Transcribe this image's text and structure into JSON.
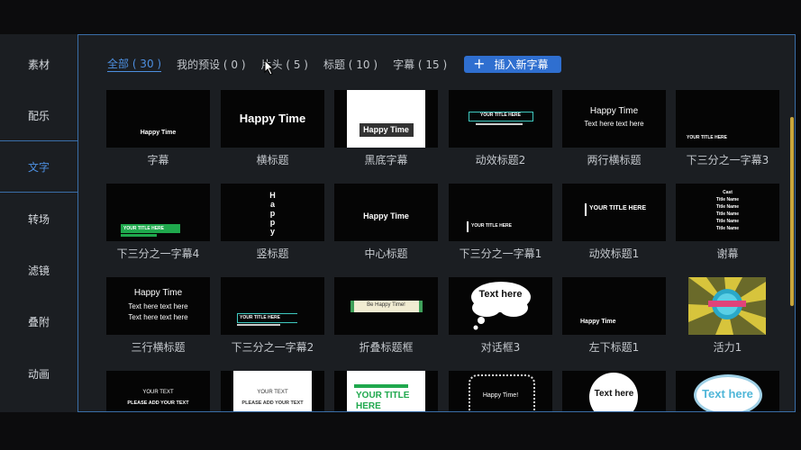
{
  "sidebar": {
    "items": [
      {
        "label": "素材"
      },
      {
        "label": "配乐"
      },
      {
        "label": "文字"
      },
      {
        "label": "转场"
      },
      {
        "label": "滤镜"
      },
      {
        "label": "叠附"
      },
      {
        "label": "动画"
      }
    ],
    "active_index": 2
  },
  "tabs": [
    {
      "label": "全部 ( 30 )"
    },
    {
      "label": "我的预设 ( 0 )"
    },
    {
      "label": "片头 ( 5 )"
    },
    {
      "label": "标题 ( 10 )"
    },
    {
      "label": "字幕 ( 15 )"
    }
  ],
  "insert_button": {
    "label": "插入新字幕"
  },
  "tiles": [
    {
      "label": "字幕",
      "preview": [
        "Happy Time"
      ]
    },
    {
      "label": "横标题",
      "preview": [
        "Happy Time"
      ]
    },
    {
      "label": "黑底字幕",
      "preview": [
        "Happy Time"
      ]
    },
    {
      "label": "动效标题2",
      "preview": [
        "YOUR TITLE HERE"
      ]
    },
    {
      "label": "两行横标题",
      "preview": [
        "Happy Time",
        "Text here text here"
      ]
    },
    {
      "label": "下三分之一字幕3",
      "preview": [
        "YOUR TITLE HERE"
      ]
    },
    {
      "label": "下三分之一字幕4",
      "preview": [
        "YOUR TITLE HERE"
      ]
    },
    {
      "label": "竖标题",
      "preview": [
        "H",
        "a",
        "p",
        "p",
        "y"
      ]
    },
    {
      "label": "中心标题",
      "preview": [
        "Happy Time"
      ]
    },
    {
      "label": "下三分之一字幕1",
      "preview": [
        "YOUR TITLE HERE"
      ]
    },
    {
      "label": "动效标题1",
      "preview": [
        "YOUR TITLE HERE"
      ]
    },
    {
      "label": "谢幕",
      "preview": [
        "Cast",
        "Title Name",
        "Title Name",
        "Title Name",
        "Title Name",
        "Title Name"
      ]
    },
    {
      "label": "三行横标题",
      "preview": [
        "Happy Time",
        "Text here text here",
        "Text here text here"
      ]
    },
    {
      "label": "下三分之一字幕2",
      "preview": [
        "YOUR TITLE HERE"
      ]
    },
    {
      "label": "折叠标题框",
      "preview": [
        "Be Happy Time!"
      ]
    },
    {
      "label": "对话框3",
      "preview": [
        "Text here"
      ]
    },
    {
      "label": "左下标题1",
      "preview": [
        "Happy Time"
      ]
    },
    {
      "label": "活力1",
      "preview": [
        ""
      ]
    },
    {
      "label": "",
      "preview": [
        "YOUR TEXT",
        "PLEASE ADD YOUR TEXT"
      ]
    },
    {
      "label": "",
      "preview": [
        "YOUR TEXT",
        "PLEASE ADD YOUR TEXT"
      ]
    },
    {
      "label": "",
      "preview": [
        "YOUR TITLE HERE"
      ]
    },
    {
      "label": "",
      "preview": [
        "Happy Time!"
      ]
    },
    {
      "label": "",
      "preview": [
        "Text here"
      ]
    },
    {
      "label": "",
      "preview": [
        "Text here"
      ]
    }
  ],
  "colors": {
    "accent": "#2f6fd0",
    "active_text": "#4d8fe0",
    "panel_bg": "#1b1e22",
    "border": "#3a6ea8",
    "green_bar": "#1fa84d",
    "scroll": "#c8a53a"
  }
}
